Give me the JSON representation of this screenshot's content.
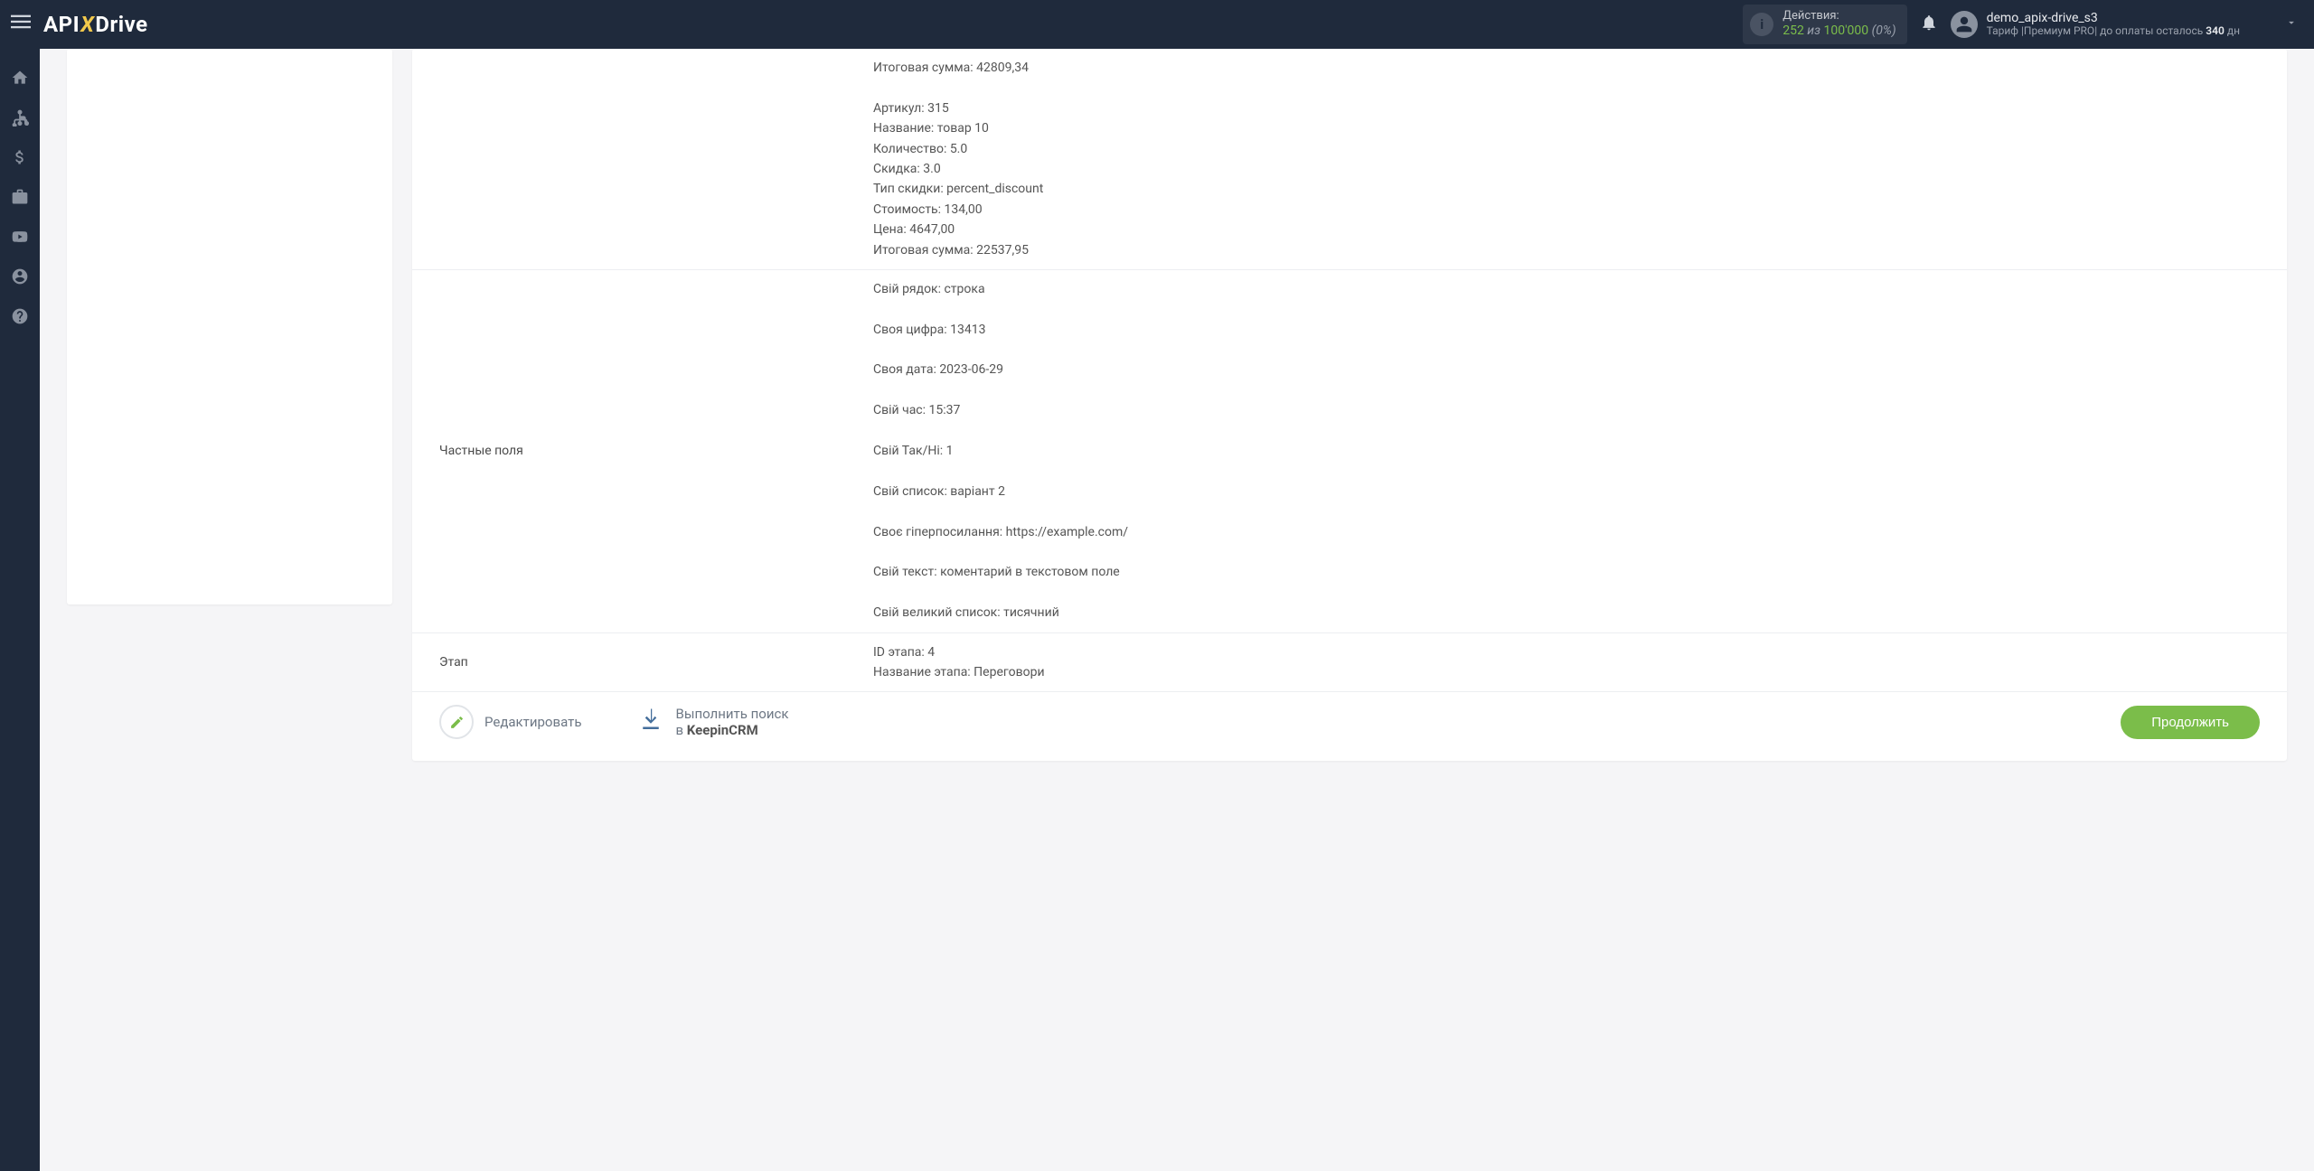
{
  "header": {
    "logo": {
      "part1": "API",
      "part2": "X",
      "part3": "Drive"
    },
    "actions": {
      "label": "Действия:",
      "used": "252",
      "sep": "из",
      "limit": "100'000",
      "pct": "(0%)"
    },
    "user": {
      "name": "demo_apix-drive_s3",
      "tariff_prefix": "Тариф |",
      "tariff_plan": "Премиум PRO",
      "tariff_suffix": "| до оплаты осталось",
      "days": "340",
      "days_unit": "дн"
    }
  },
  "rows": {
    "products": {
      "label": "",
      "value": "Итоговая сумма: 42809,34\n\nАртикул: 315\nНазвание: товар 10\nКоличество: 5.0\nСкидка: 3.0\nТип скидки: percent_discount\nСтоимость: 134,00\nЦена: 4647,00\nИтоговая сумма: 22537,95"
    },
    "custom_fields": {
      "label": "Частные поля",
      "value": "Свій рядок: строка\n\nСвоя цифра: 13413\n\nСвоя дата: 2023-06-29\n\nСвій час: 15:37\n\nСвій Так/Ні: 1\n\nСвій список: варіант 2\n\nСвоє гіперпосилання: https://example.com/\n\nСвій текст: коментарий в текстовом поле\n\nСвій великий список: тисячний"
    },
    "stage": {
      "label": "Этап",
      "value": "ID этапа: 4\nНазвание этапа: Переговори"
    }
  },
  "actions_row": {
    "edit": "Редактировать",
    "search_line1": "Выполнить поиск",
    "search_line2_prefix": "в ",
    "search_line2_strong": "KeepinCRM",
    "continue": "Продолжить"
  }
}
